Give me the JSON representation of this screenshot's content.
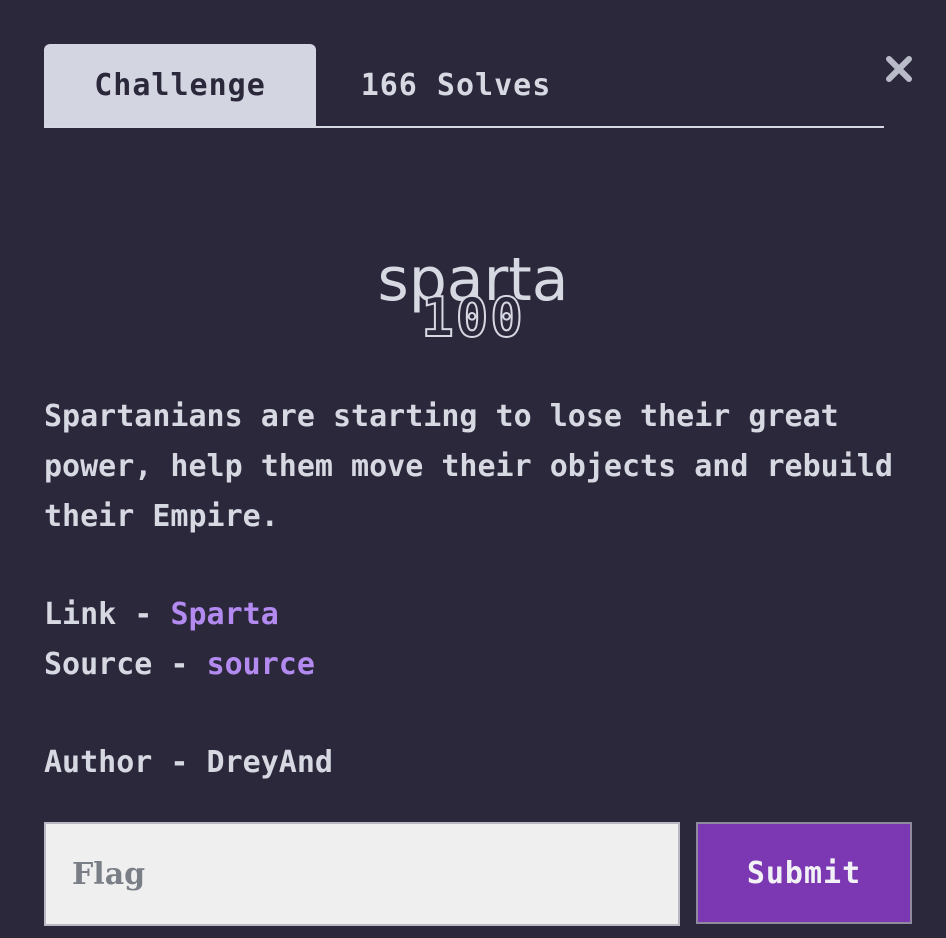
{
  "tabs": [
    {
      "label": "Challenge",
      "active": true
    },
    {
      "label": "166 Solves",
      "active": false
    }
  ],
  "close_icon": "close-icon",
  "challenge": {
    "name": "sparta",
    "points": "100",
    "description": "Spartanians are starting to lose their great power, help them move their objects and rebuild their Empire.",
    "link_label": "Link - ",
    "link_text": "Sparta",
    "source_label": "Source - ",
    "source_text": "source",
    "author": "Author - DreyAnd"
  },
  "form": {
    "flag_placeholder": "Flag",
    "flag_value": "",
    "submit_label": "Submit"
  },
  "colors": {
    "background": "#2c283c",
    "text": "#d6d8e2",
    "link": "#b38af0",
    "submit": "#7b38b2"
  }
}
